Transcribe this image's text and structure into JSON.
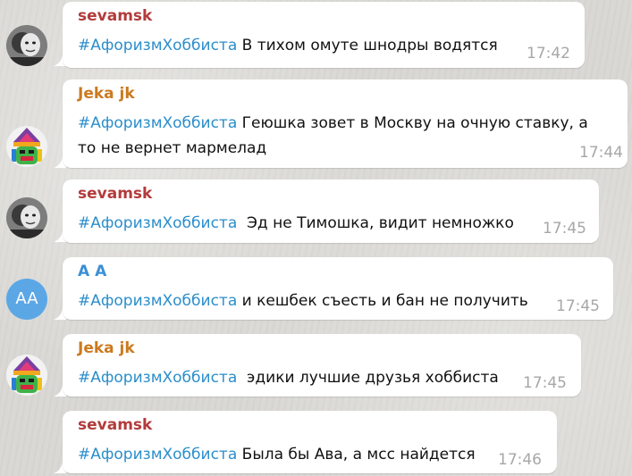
{
  "colors": {
    "name_red": "#b33b3b",
    "name_orange": "#cc7a1f",
    "name_blue": "#3a8fd6",
    "hashtag": "#2b8ecb",
    "time": "#a7a7a7"
  },
  "messages": [
    {
      "author": "sevamsk",
      "author_color": "#b33b3b",
      "avatar": "mask-photo-icon",
      "hashtag": "#АфоризмХоббиста",
      "text_line1": " В тихом омуте шнодры водятся",
      "text_line2": "",
      "time": "17:42"
    },
    {
      "author": "Jeka jk",
      "author_color": "#cc7a1f",
      "avatar": "colorful-clown-icon",
      "hashtag": "#АфоризмХоббиста",
      "text_line1": " Геюшка зовет в Москву на очную ставку, а",
      "text_line2": "то не вернет мармелад",
      "time": "17:44"
    },
    {
      "author": "sevamsk",
      "author_color": "#b33b3b",
      "avatar": "mask-photo-icon",
      "hashtag": "#АфоризмХоббиста",
      "text_line1": "  Эд не Тимошка, видит немножко",
      "text_line2": "",
      "time": "17:45"
    },
    {
      "author": "A A",
      "author_color": "#3a8fd6",
      "avatar": "initials-avatar",
      "avatar_initials": "AA",
      "hashtag": "#АфоризмХоббиста",
      "text_line1": " и кешбек съесть и бан не получить",
      "text_line2": "",
      "time": "17:45"
    },
    {
      "author": "Jeka jk",
      "author_color": "#cc7a1f",
      "avatar": "colorful-clown-icon",
      "hashtag": "#АфоризмХоббиста",
      "text_line1": "  эдики лучшие друзья хоббиста",
      "text_line2": "",
      "time": "17:45"
    },
    {
      "author": "sevamsk",
      "author_color": "#b33b3b",
      "avatar": "none",
      "hashtag": "#АфоризмХоббиста",
      "text_line1": " Была бы Ава, а мсс найдется",
      "text_line2": "",
      "time": "17:46"
    }
  ]
}
